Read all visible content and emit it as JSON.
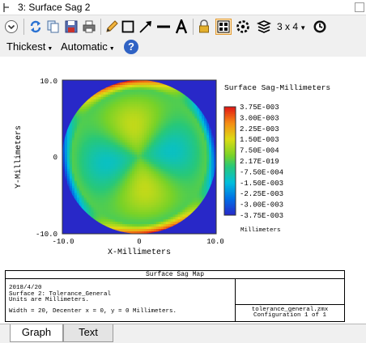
{
  "window": {
    "title": "3: Surface Sag 2"
  },
  "toolbar": {
    "icons": [
      "settings-dropdown-icon",
      "refresh-icon",
      "copy-icon",
      "save-icon",
      "print-icon",
      "pencil-icon",
      "rectangle-icon",
      "arrow-icon",
      "line-icon",
      "text-icon",
      "lock-icon",
      "layout-icon",
      "layers-icon",
      "clock-icon"
    ],
    "layout_label": "3 x 4"
  },
  "toolbar2": {
    "line_width": "Thickest",
    "scale": "Automatic",
    "help_label": "?"
  },
  "colors": {
    "accent": "#e39b2f",
    "plot_background": "#2828c8"
  },
  "chart_data": {
    "type": "heatmap",
    "title": "Surface Sag-Millimeters",
    "xlabel": "X-Millimeters",
    "ylabel": "Y-Millimeters",
    "xlim": [
      -10,
      10
    ],
    "ylim": [
      -10,
      10
    ],
    "x_ticks": [
      "-10.0",
      "0",
      "10.0"
    ],
    "y_ticks": [
      "10.0",
      "0",
      "-10.0"
    ],
    "colorbar_labels": [
      "3.75E-003",
      "3.00E-003",
      "2.25E-003",
      "1.50E-003",
      "7.50E-004",
      "2.17E-019",
      "-7.50E-004",
      "-1.50E-003",
      "-2.25E-003",
      "-3.00E-003",
      "-3.75E-003"
    ],
    "colorbar_unit": "Millimeters",
    "range": [
      -0.00375,
      0.00375
    ]
  },
  "info": {
    "header": "Surface Sag Map",
    "lines": [
      "2018/4/20",
      "Surface 2: Tolerance_General",
      "Units are Millimeters.",
      "Width = 20, Decenter x = 0, y = 0 Millimeters."
    ],
    "file": "tolerance_general.zmx",
    "configuration": "Configuration 1 of 1"
  },
  "tabs": [
    {
      "label": "Graph"
    },
    {
      "label": "Text"
    }
  ]
}
